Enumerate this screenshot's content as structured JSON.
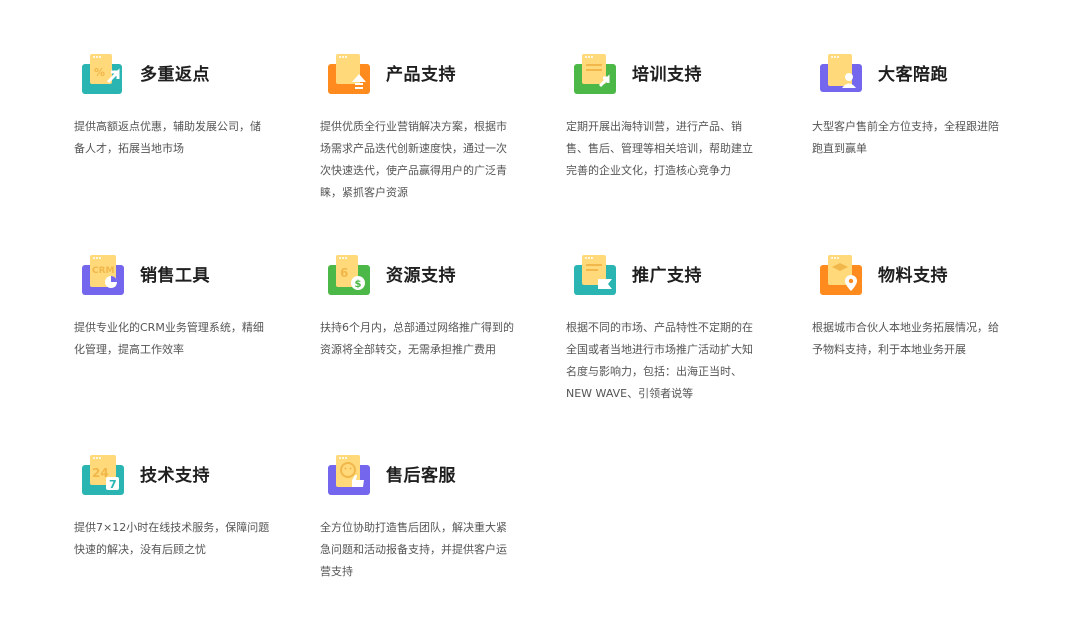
{
  "features": [
    {
      "title": "多重返点",
      "desc": "提供高额返点优惠，辅助发展公司，储备人才，拓展当地市场",
      "icon": "rebate-icon"
    },
    {
      "title": "产品支持",
      "desc": "提供优质全行业营销解决方案，根据市场需求产品迭代创新速度快，通过一次次快速迭代，使产品赢得用户的广泛青睐，紧抓客户资源",
      "icon": "product-upgrade-icon"
    },
    {
      "title": "培训支持",
      "desc": "定期开展出海特训营，进行产品、销售、售后、管理等相关培训，帮助建立完善的企业文化，打造核心竞争力",
      "icon": "training-icon"
    },
    {
      "title": "大客陪跑",
      "desc": "大型客户售前全方位支持，全程跟进陪跑直到赢单",
      "icon": "vip-client-icon"
    },
    {
      "title": "销售工具",
      "desc": "提供专业化的CRM业务管理系统，精细化管理，提高工作效率",
      "icon": "crm-icon"
    },
    {
      "title": "资源支持",
      "desc": "扶持6个月内，总部通过网络推广得到的资源将全部转交，无需承担推广费用",
      "icon": "resource-money-icon"
    },
    {
      "title": "推广支持",
      "desc": "根据不同的市场、产品特性不定期的在全国或者当地进行市场推广活动扩大知名度与影响力，包括：出海正当时、NEW WAVE、引领者说等",
      "icon": "promotion-flag-icon"
    },
    {
      "title": "物料支持",
      "desc": "根据城市合伙人本地业务拓展情况，给予物料支持，利于本地业务开展",
      "icon": "materials-location-icon"
    },
    {
      "title": "技术支持",
      "desc": "提供7×12小时在线技术服务，保障问题快速的解决，没有后顾之忧",
      "icon": "tech-24-7-icon"
    },
    {
      "title": "售后客服",
      "desc": "全方位协助打造售后团队，解决重大紧急问题和活动报备支持，并提供客户运营支持",
      "icon": "after-sales-thumbs-icon"
    }
  ],
  "colors": {
    "teal": "#2AB5B2",
    "orange": "#FF8A1E",
    "green": "#4CB847",
    "purple": "#7467EE",
    "yellow": "#FFD97A",
    "title": "#1F1F1F",
    "text": "#555555"
  }
}
